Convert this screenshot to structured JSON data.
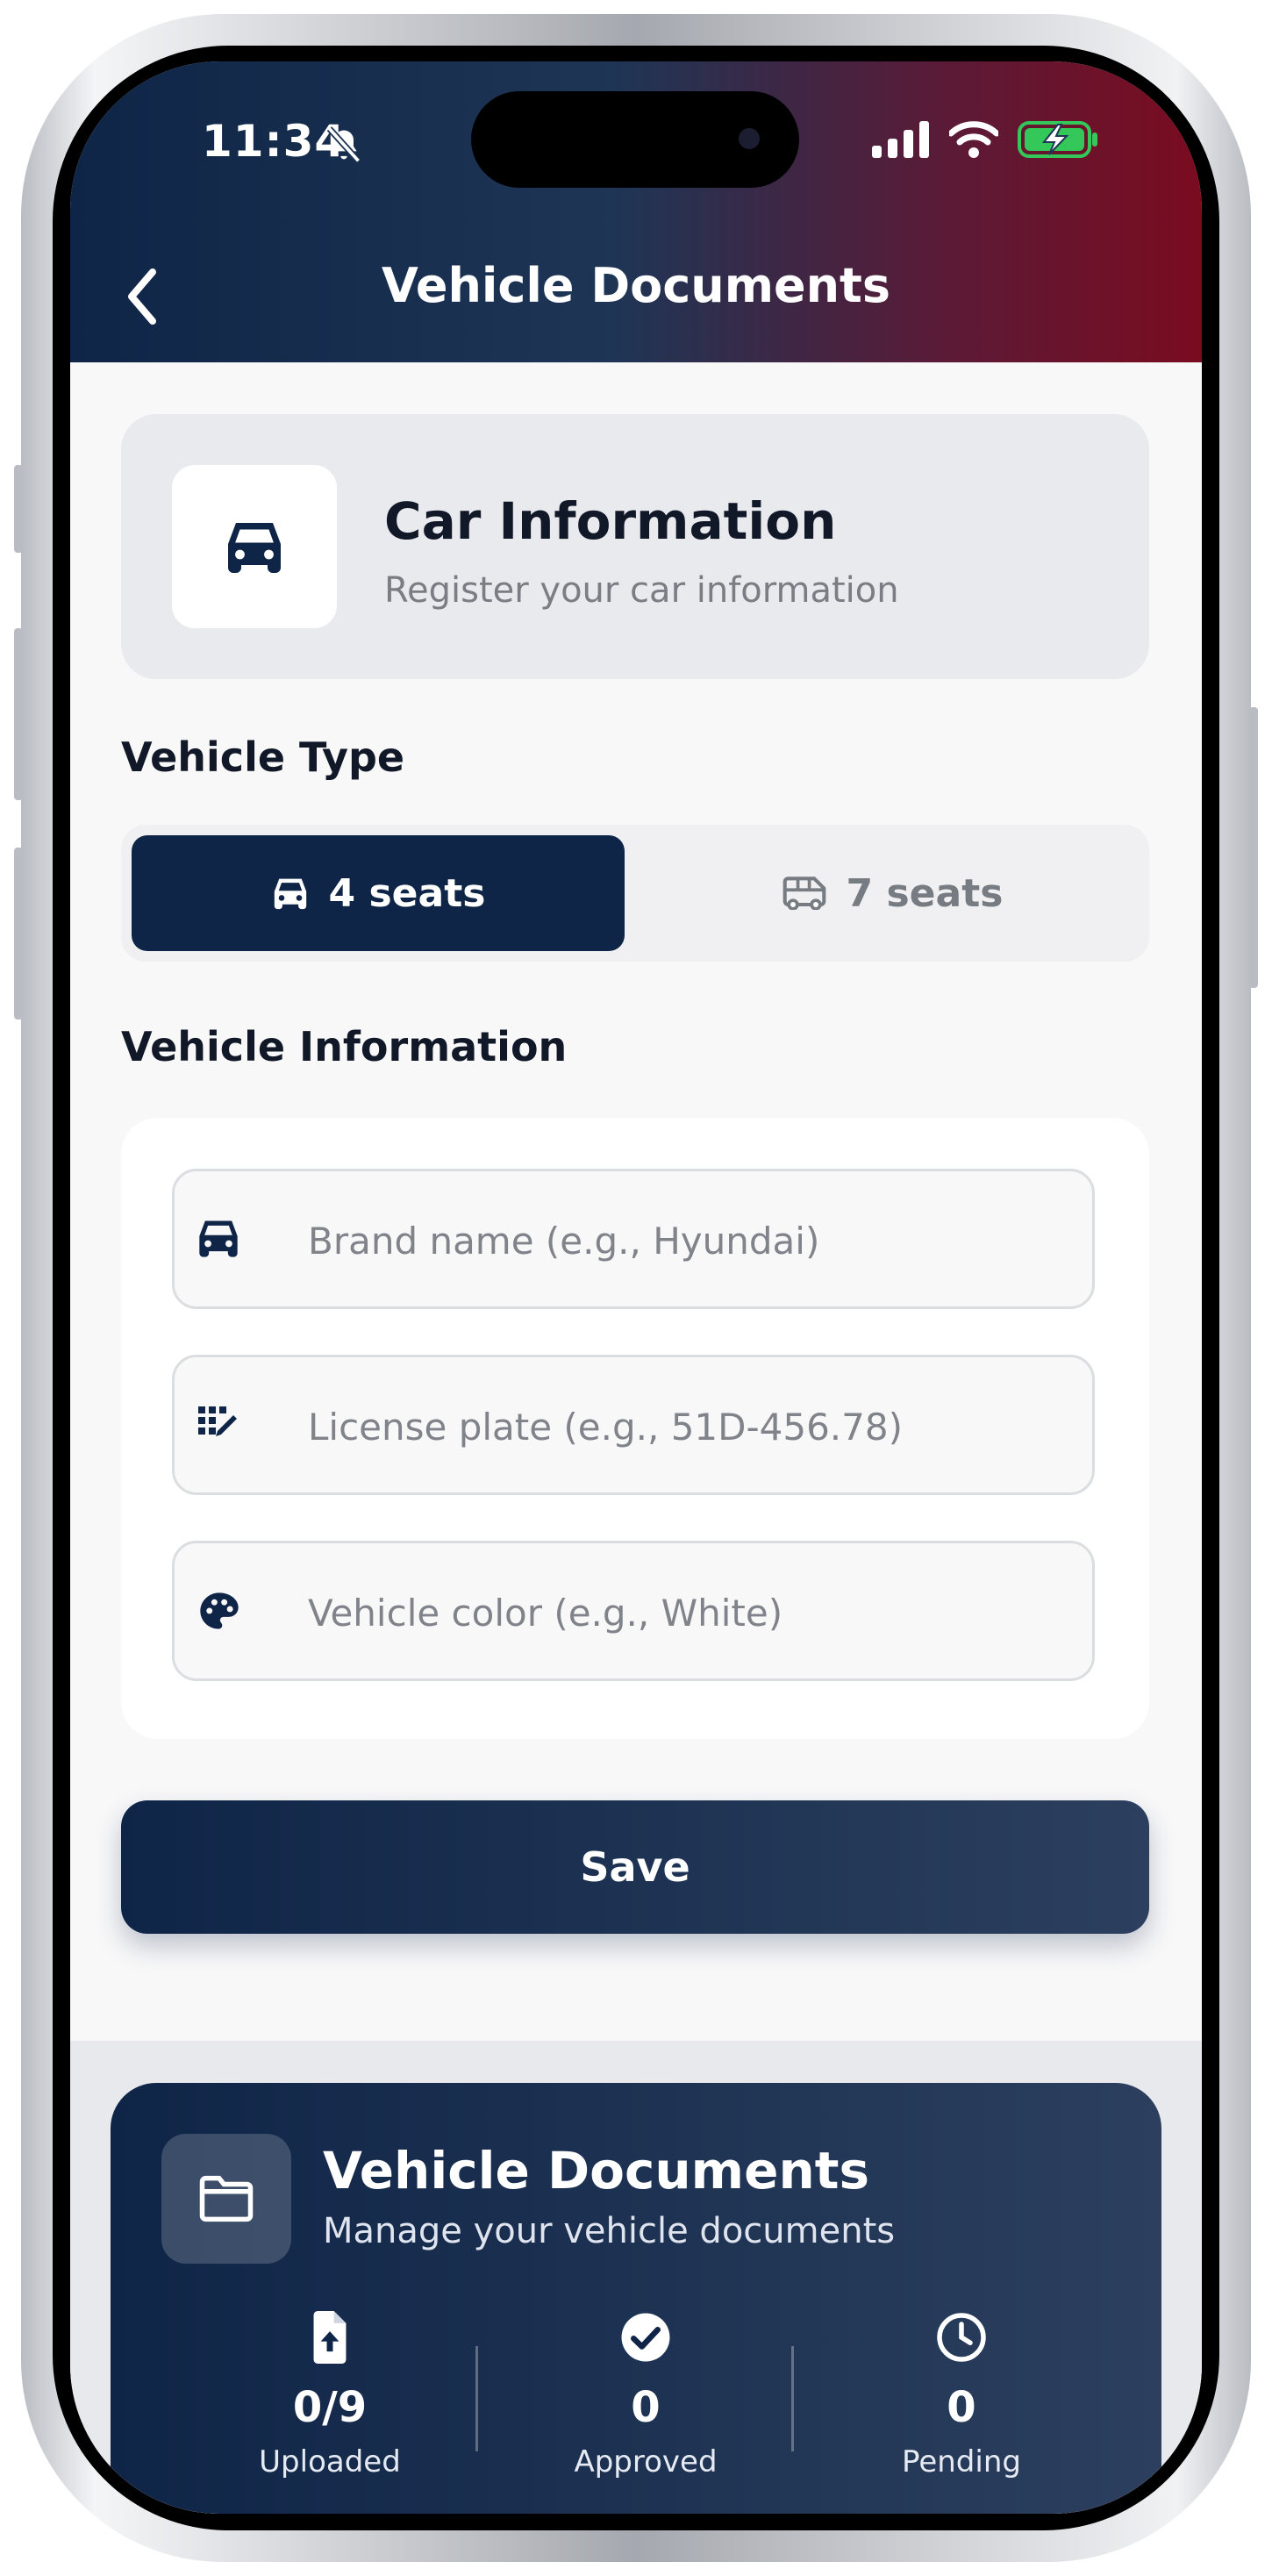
{
  "status_bar": {
    "time": "11:34"
  },
  "header": {
    "title": "Vehicle Documents"
  },
  "car_info": {
    "title": "Car Information",
    "subtitle": "Register your car information"
  },
  "vehicle_type": {
    "label": "Vehicle Type",
    "options": [
      {
        "label": "4 seats",
        "selected": true,
        "icon": "car-icon"
      },
      {
        "label": "7 seats",
        "selected": false,
        "icon": "van-icon"
      }
    ]
  },
  "vehicle_info": {
    "label": "Vehicle Information",
    "fields": [
      {
        "icon": "car-icon",
        "value": "",
        "placeholder": "Brand name (e.g., Hyundai)"
      },
      {
        "icon": "license-plate-icon",
        "value": "",
        "placeholder": "License plate (e.g., 51D-456.78)"
      },
      {
        "icon": "palette-icon",
        "value": "",
        "placeholder": "Vehicle color (e.g., White)"
      }
    ]
  },
  "save_label": "Save",
  "documents": {
    "title": "Vehicle Documents",
    "subtitle": "Manage your vehicle documents",
    "stats": [
      {
        "icon": "file-upload-icon",
        "value": "0/9",
        "label": "Uploaded"
      },
      {
        "icon": "check-circle-icon",
        "value": "0",
        "label": "Approved"
      },
      {
        "icon": "clock-icon",
        "value": "0",
        "label": "Pending"
      }
    ]
  },
  "colors": {
    "primary": "#0f2547",
    "header_gradient_end": "#7a0c20",
    "battery_green": "#34c759"
  }
}
